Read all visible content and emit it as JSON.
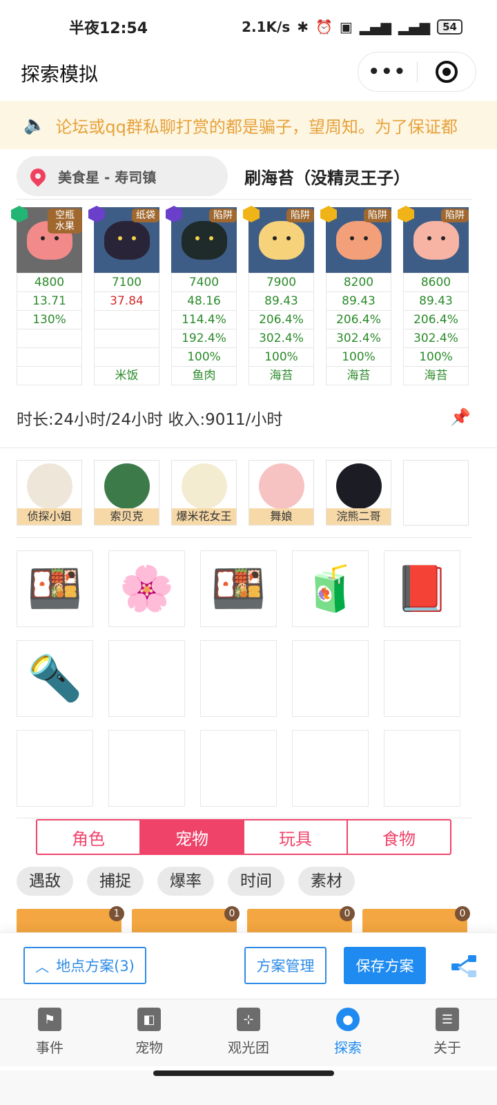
{
  "status_bar": {
    "time": "半夜12:54",
    "net_speed": "2.1K/s",
    "battery": "54"
  },
  "nav": {
    "title": "探索模拟"
  },
  "notice": {
    "text": "论坛或qq群私聊打赏的都是骗子，望周知。为了保证都"
  },
  "location": {
    "name": "美食星 - 寿司镇",
    "plan_title": "刷海苔（没精灵王子）"
  },
  "pets": [
    {
      "tag": "空瓶水果",
      "rarity": "green",
      "color": "#f28a8a",
      "values": [
        "4800",
        "13.71",
        "130%",
        "",
        "",
        ""
      ],
      "value_colors": [
        "green",
        "green",
        "green",
        "green",
        "green",
        "green"
      ],
      "bg": "gray"
    },
    {
      "tag": "纸袋",
      "rarity": "purple",
      "color": "#2a2438",
      "values": [
        "7100",
        "37.84",
        "",
        "",
        "",
        "米饭"
      ],
      "value_colors": [
        "green",
        "red",
        "green",
        "green",
        "green",
        "green"
      ],
      "bg": "blue"
    },
    {
      "tag": "陷阱",
      "rarity": "purple",
      "color": "#1f2a2a",
      "values": [
        "7400",
        "48.16",
        "114.4%",
        "192.4%",
        "100%",
        "鱼肉"
      ],
      "value_colors": [
        "green",
        "green",
        "green",
        "green",
        "green",
        "green"
      ],
      "bg": "blue"
    },
    {
      "tag": "陷阱",
      "rarity": "gold",
      "color": "#f6d27a",
      "values": [
        "7900",
        "89.43",
        "206.4%",
        "302.4%",
        "100%",
        "海苔"
      ],
      "value_colors": [
        "green",
        "green",
        "green",
        "green",
        "green",
        "green"
      ],
      "bg": "blue"
    },
    {
      "tag": "陷阱",
      "rarity": "gold",
      "color": "#f3a07a",
      "values": [
        "8200",
        "89.43",
        "206.4%",
        "302.4%",
        "100%",
        "海苔"
      ],
      "value_colors": [
        "green",
        "green",
        "green",
        "green",
        "green",
        "green"
      ],
      "bg": "blue"
    },
    {
      "tag": "陷阱",
      "rarity": "gold",
      "color": "#f7b3a3",
      "values": [
        "8600",
        "89.43",
        "206.4%",
        "302.4%",
        "100%",
        "海苔"
      ],
      "value_colors": [
        "green",
        "green",
        "green",
        "green",
        "green",
        "green"
      ],
      "bg": "blue"
    }
  ],
  "summary": {
    "text": "时长:24小时/24小时 收入:9011/小时"
  },
  "characters": [
    {
      "name": "侦探小姐",
      "color": "#efe6da"
    },
    {
      "name": "索贝克",
      "color": "#3d7a4a"
    },
    {
      "name": "爆米花女王",
      "color": "#f4ecd0"
    },
    {
      "name": "舞娘",
      "color": "#f7c2c2"
    },
    {
      "name": "浣熊二哥",
      "color": "#1c1c24"
    },
    {
      "name": "",
      "color": ""
    }
  ],
  "items": [
    {
      "icon": "bento-box-icon",
      "glyph": "🍱"
    },
    {
      "icon": "flower-medal-icon",
      "glyph": "🌸"
    },
    {
      "icon": "bento-box-icon",
      "glyph": "🍱"
    },
    {
      "icon": "blender-icon",
      "glyph": "🧃"
    },
    {
      "icon": "red-wallet-icon",
      "glyph": "📕"
    },
    {
      "icon": "flashlight-icon",
      "glyph": "🔦"
    },
    {
      "icon": "",
      "glyph": ""
    },
    {
      "icon": "",
      "glyph": ""
    },
    {
      "icon": "",
      "glyph": ""
    },
    {
      "icon": "",
      "glyph": ""
    },
    {
      "icon": "",
      "glyph": ""
    },
    {
      "icon": "",
      "glyph": ""
    },
    {
      "icon": "",
      "glyph": ""
    },
    {
      "icon": "",
      "glyph": ""
    },
    {
      "icon": "",
      "glyph": ""
    }
  ],
  "segment_tabs": [
    {
      "label": "角色",
      "active": false
    },
    {
      "label": "宠物",
      "active": true
    },
    {
      "label": "玩具",
      "active": false
    },
    {
      "label": "食物",
      "active": false
    }
  ],
  "chips": [
    "遇敌",
    "捕捉",
    "爆率",
    "时间",
    "素材"
  ],
  "results": [
    {
      "count": "1"
    },
    {
      "count": "0"
    },
    {
      "count": "0"
    },
    {
      "count": "0"
    }
  ],
  "actions": {
    "location_plan": "地点方案(3)",
    "manage": "方案管理",
    "save": "保存方案"
  },
  "tabbar": [
    {
      "label": "事件",
      "icon": "flag-icon",
      "active": false
    },
    {
      "label": "宠物",
      "icon": "pet-icon",
      "active": false
    },
    {
      "label": "观光团",
      "icon": "tour-icon",
      "active": false
    },
    {
      "label": "探索",
      "icon": "explore-icon",
      "active": true
    },
    {
      "label": "关于",
      "icon": "about-icon",
      "active": false
    }
  ],
  "colors": {
    "accent_pink": "#f0436a",
    "accent_blue": "#1f8bf0",
    "notice_text": "#e6a23c",
    "value_green": "#2a8a2a",
    "value_red": "#d02a2a"
  }
}
